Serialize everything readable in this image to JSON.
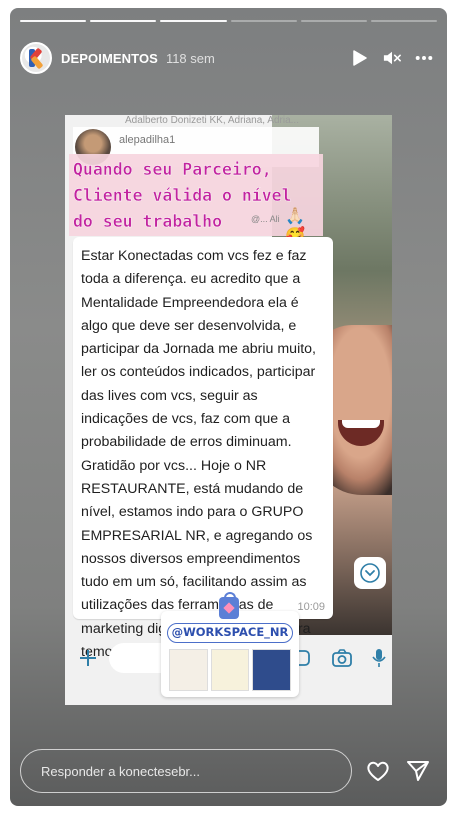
{
  "story": {
    "account_name": "DEPOIMENTOS",
    "time_ago": "118 sem",
    "segments_done": 3,
    "segments_total": 6
  },
  "media": {
    "group_participants": "Adalberto Donizeti KK, Adriana, Adria...",
    "chat_username": "alepadilha1",
    "headline": "Quando seu Parceiro, Cliente válida o nível do seu trabalho",
    "headline_emojis": "🙏🏻🥰",
    "headline_tag_fragment": "@... Ali",
    "message": "Estar Konectadas com vcs fez e faz toda a diferença. eu acredito que a Mentalidade Empreendedora ela é algo que deve ser desenvolvida, e participar da Jornada me abriu muito, ler os conteúdos indicados, participar das lives com vcs, seguir as indicações de vcs, faz com que a probabilidade de erros diminuam. Gratidão por vcs... Hoje o NR RESTAURANTE, está mudando de nível, estamos indo para o GRUPO EMPRESARIAL NR, e agregando os nossos diversos empreendimentos tudo em um só, facilitando assim as utilizações das ferramentas de marketing digital... Gratidão.... agora temos bem mais trabalho kkkk",
    "message_time": "10:09",
    "sticker_handle": "@WORKSPACE_NR"
  },
  "reply": {
    "placeholder": "Responder a konectesebr..."
  },
  "icons": {
    "play": "play-icon",
    "mute": "mute-icon",
    "more": "more-icon",
    "like": "heart-icon",
    "share": "send-icon"
  }
}
